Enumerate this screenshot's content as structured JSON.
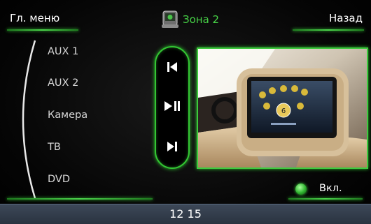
{
  "header": {
    "menu_label": "Гл. меню",
    "zone_label": "Зона 2",
    "zone_icon": "car-seat-screen-icon",
    "back_label": "Назад"
  },
  "sources": [
    {
      "label": "AUX 1"
    },
    {
      "label": "AUX 2"
    },
    {
      "label": "Камера"
    },
    {
      "label": "ТВ"
    },
    {
      "label": "DVD"
    }
  ],
  "transport": {
    "prev_icon": "skip-previous-icon",
    "play_pause_icon": "play-pause-icon",
    "next_icon": "skip-next-icon"
  },
  "preview": {
    "description_icon": "headrest-monitor-preview-image",
    "screen_badge": "6"
  },
  "power": {
    "label": "Вкл.",
    "state": "on"
  },
  "status_bar": {
    "time": "12 15"
  },
  "colors": {
    "accent": "#3ec93e",
    "zone_text": "#47d347",
    "status_bar": "#343e4c"
  }
}
